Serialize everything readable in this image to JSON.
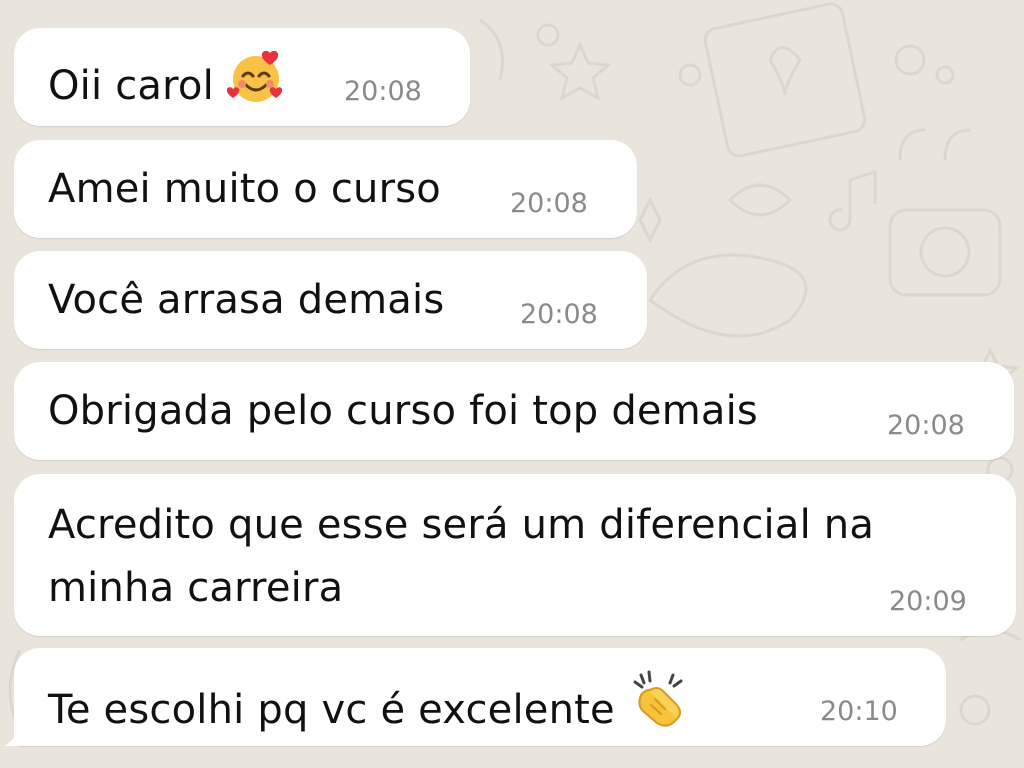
{
  "messages": [
    {
      "text": "Oii carol",
      "time": "20:08",
      "emoji": "smiling-face-with-hearts"
    },
    {
      "text": "Amei muito o curso",
      "time": "20:08"
    },
    {
      "text": "Você arrasa demais",
      "time": "20:08"
    },
    {
      "text": "Obrigada pelo curso foi top demais",
      "time": "20:08"
    },
    {
      "text_line1": "Acredito que esse será um diferencial na",
      "text_line2": "minha carreira",
      "time": "20:09"
    },
    {
      "text": "Te escolhi pq vc é excelente",
      "time": "20:10",
      "emoji": "clapping-hands"
    }
  ],
  "colors": {
    "wallpaper": "#e9e5dc",
    "bubble": "#ffffff",
    "text": "#111111",
    "timestamp": "#8a8a8a"
  }
}
